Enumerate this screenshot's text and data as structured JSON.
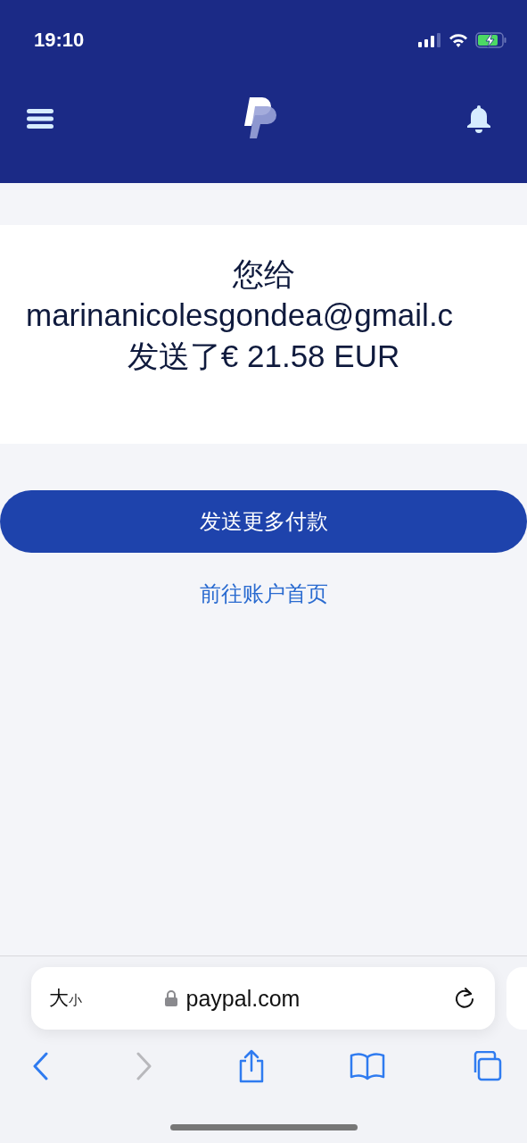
{
  "status_bar": {
    "time": "19:10"
  },
  "confirmation": {
    "line_1": "您给",
    "recipient": "marinanicolesgondea@gmail.c",
    "line_3": "发送了€ 21.58 EUR"
  },
  "primary_button": {
    "label": "发送更多付款"
  },
  "secondary_link": {
    "label": "前往账户首页"
  },
  "browser": {
    "text_size": "大小",
    "url": "paypal.com"
  },
  "toolbar": [
    {
      "kind": "back",
      "disabled": false
    },
    {
      "kind": "forward",
      "disabled": true
    },
    {
      "kind": "share",
      "disabled": false
    },
    {
      "kind": "bookmarks",
      "disabled": false
    },
    {
      "kind": "tabs",
      "disabled": false
    }
  ]
}
